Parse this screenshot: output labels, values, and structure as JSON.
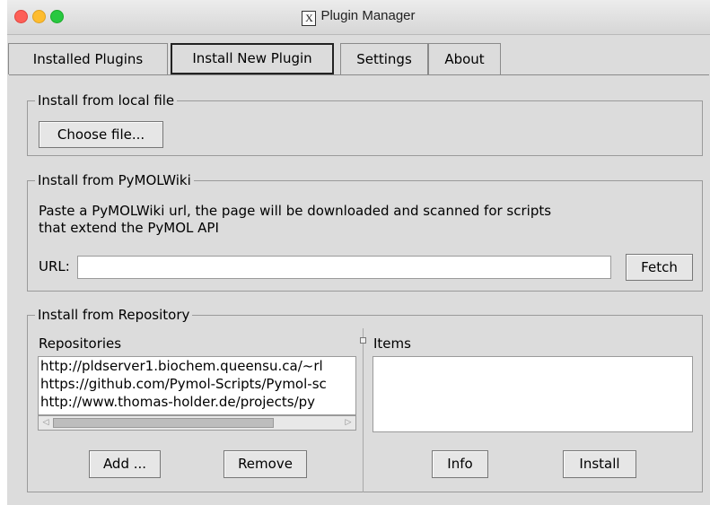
{
  "window": {
    "title": "Plugin Manager"
  },
  "tabs": [
    {
      "label": "Installed Plugins"
    },
    {
      "label": "Install New Plugin"
    },
    {
      "label": "Settings"
    },
    {
      "label": "About"
    }
  ],
  "local_file": {
    "legend": "Install from local file",
    "choose_button": "Choose file..."
  },
  "pymolwiki": {
    "legend": "Install from PyMOLWiki",
    "description_line1": "Paste a PyMOLWiki url, the page will be downloaded and scanned for scripts",
    "description_line2": "that extend the PyMOL API",
    "url_label": "URL:",
    "url_value": "",
    "fetch_button": "Fetch"
  },
  "repository": {
    "legend": "Install from Repository",
    "repositories_label": "Repositories",
    "repositories": [
      "http://pldserver1.biochem.queensu.ca/~rl",
      "https://github.com/Pymol-Scripts/Pymol-sc",
      "http://www.thomas-holder.de/projects/py"
    ],
    "items_label": "Items",
    "items": [],
    "add_button": "Add ...",
    "remove_button": "Remove",
    "info_button": "Info",
    "install_button": "Install"
  }
}
